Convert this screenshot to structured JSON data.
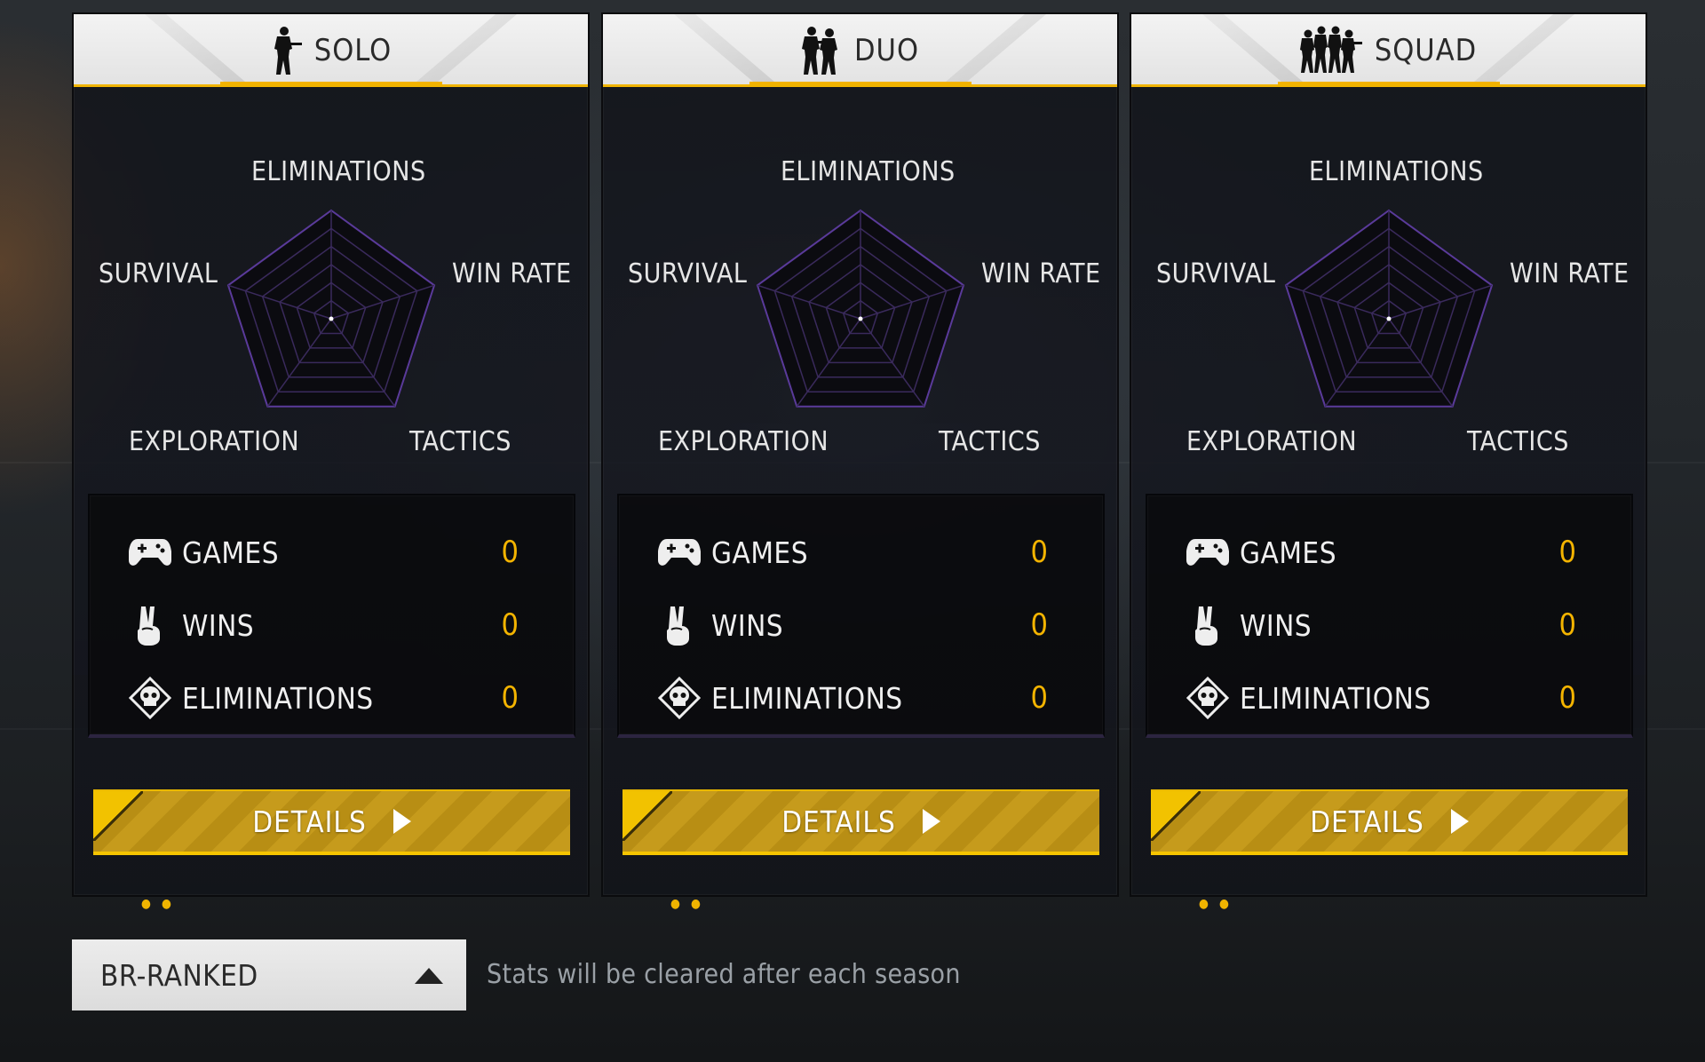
{
  "radar_labels": {
    "top": "ELIMINATIONS",
    "left": "SURVIVAL",
    "right": "WIN RATE",
    "bottom_left": "EXPLORATION",
    "bottom_right": "TACTICS"
  },
  "stat_labels": {
    "games": "GAMES",
    "wins": "WINS",
    "eliminations": "ELIMINATIONS"
  },
  "panels": [
    {
      "mode": "SOLO",
      "mode_icon": "soldier-solo-icon",
      "stats": {
        "games": "0",
        "wins": "0",
        "eliminations": "0"
      },
      "radar_values": {
        "eliminations": 0,
        "win_rate": 0,
        "tactics": 0,
        "exploration": 0,
        "survival": 0
      },
      "details_label": "DETAILS"
    },
    {
      "mode": "DUO",
      "mode_icon": "soldiers-duo-icon",
      "stats": {
        "games": "0",
        "wins": "0",
        "eliminations": "0"
      },
      "radar_values": {
        "eliminations": 0,
        "win_rate": 0,
        "tactics": 0,
        "exploration": 0,
        "survival": 0
      },
      "details_label": "DETAILS"
    },
    {
      "mode": "SQUAD",
      "mode_icon": "soldiers-squad-icon",
      "stats": {
        "games": "0",
        "wins": "0",
        "eliminations": "0"
      },
      "radar_values": {
        "eliminations": 0,
        "win_rate": 0,
        "tactics": 0,
        "exploration": 0,
        "survival": 0
      },
      "details_label": "DETAILS"
    }
  ],
  "mode_selector": {
    "value": "BR-RANKED",
    "icon": "caret-up-icon"
  },
  "season_note": "Stats will be cleared after each season",
  "colors": {
    "accent": "#f2b200",
    "stat_value": "#f4b400",
    "radar_grid": "#3a2a5c"
  }
}
